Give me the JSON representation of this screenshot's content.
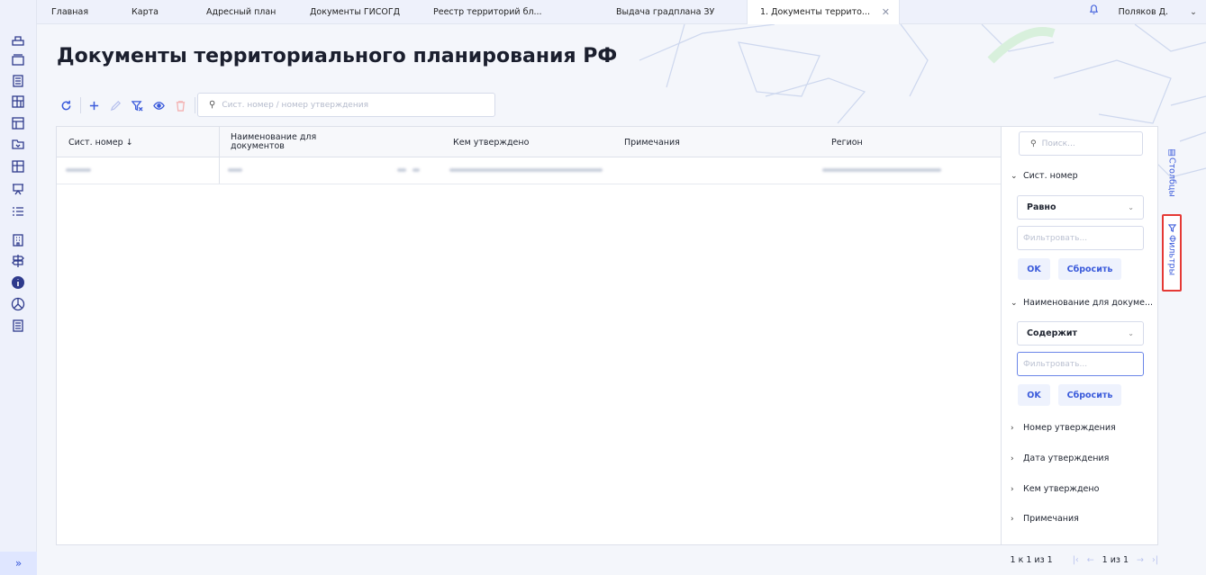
{
  "tabs": [
    {
      "label": "Главная"
    },
    {
      "label": "Карта"
    },
    {
      "label": "Адресный план"
    },
    {
      "label": "Документы ГИСОГД"
    },
    {
      "label": "Реестр территорий бл..."
    },
    {
      "label": "Выдача градплана ЗУ"
    },
    {
      "label": "1. Документы террито..."
    }
  ],
  "user": {
    "name": "Поляков Д."
  },
  "page": {
    "title": "Документы территориального планирования РФ"
  },
  "search": {
    "placeholder": "Сист. номер / номер утверждения"
  },
  "grid": {
    "columns": [
      {
        "label": "Сист. номер ↓"
      },
      {
        "label": "Наименование для документов"
      },
      {
        "label": "Кем утверждено"
      },
      {
        "label": "Примечания"
      },
      {
        "label": "Регион"
      }
    ]
  },
  "filters": {
    "search_placeholder": "Поиск...",
    "sections": [
      {
        "label": "Сист. номер",
        "operator": "Равно",
        "input_placeholder": "Фильтровать...",
        "ok": "OK",
        "reset": "Сбросить"
      },
      {
        "label": "Наименование для докуме...",
        "operator": "Содержит",
        "input_placeholder": "Фильтровать...",
        "ok": "OK",
        "reset": "Сбросить"
      }
    ],
    "collapsed": [
      {
        "label": "Номер утверждения"
      },
      {
        "label": "Дата утверждения"
      },
      {
        "label": "Кем утверждено"
      },
      {
        "label": "Примечания"
      }
    ]
  },
  "side_tabs": {
    "columns": "Столбцы",
    "filters": "Фильтры"
  },
  "pagination": {
    "range": "1 к 1 из 1",
    "page": "1 из 1"
  },
  "colors": {
    "accent": "#3b5bdb",
    "highlight": "#e53935"
  }
}
